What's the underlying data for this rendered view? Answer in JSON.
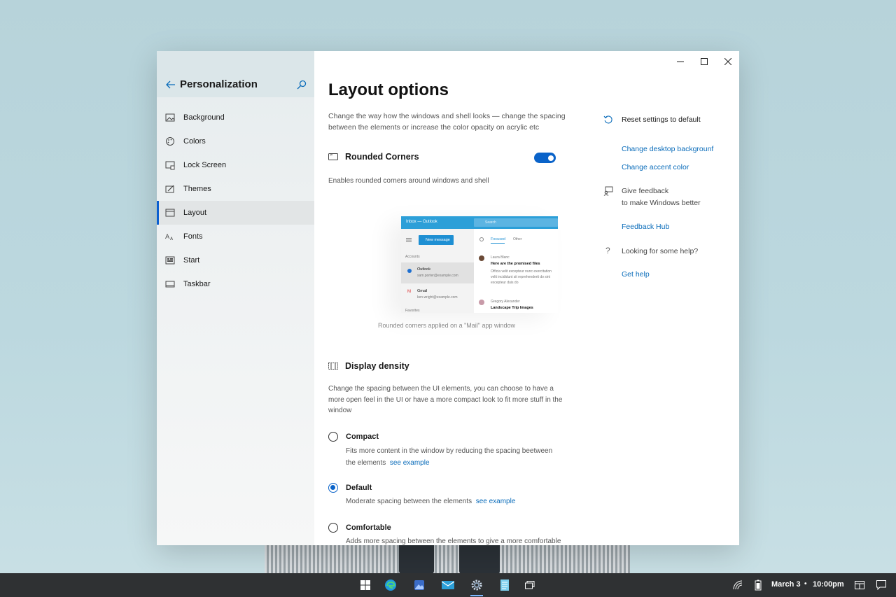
{
  "sidebar": {
    "title": "Personalization",
    "items": [
      {
        "label": "Background",
        "icon": "image-icon"
      },
      {
        "label": "Colors",
        "icon": "palette-icon"
      },
      {
        "label": "Lock Screen",
        "icon": "lock-screen-icon"
      },
      {
        "label": "Themes",
        "icon": "themes-icon"
      },
      {
        "label": "Layout",
        "icon": "layout-icon",
        "active": true
      },
      {
        "label": "Fonts",
        "icon": "fonts-icon"
      },
      {
        "label": "Start",
        "icon": "start-icon"
      },
      {
        "label": "Taskbar",
        "icon": "taskbar-icon"
      }
    ]
  },
  "main": {
    "title": "Layout options",
    "intro": "Change the way how the windows and shell looks — change the spacing between the elements or increase the color opacity on acrylic etc",
    "rounded": {
      "heading": "Rounded Corners",
      "toggle_on": true,
      "description": "Enables rounded corners around windows and shell",
      "caption": "Rounded corners applied on a \"Mail\" app window"
    },
    "preview": {
      "app_title": "Inbox — Outlook",
      "search": "Search",
      "new_message": "New message",
      "accounts": "Accounts",
      "acct1_name": "Outlook",
      "acct1_email": "sam.porter@example.com",
      "acct2_name": "Gmail",
      "acct2_email": "ken.wright@example.com",
      "favorites": "Favorites",
      "tab_focused": "Focused",
      "tab_other": "Other",
      "msg1_from": "Laura Blanc",
      "msg1_subject": "Here are the promised files",
      "msg1_body": "Officia velit excepteur nunc exercitation velit incididunt sit reprehenderit do sint excepteur duis do",
      "msg2_from": "Gregory Alexander",
      "msg2_subject": "Landscape Trip Images"
    },
    "density": {
      "heading": "Display density",
      "description": "Change the spacing between the UI elements, you can choose to have a more open feel in the UI or have a more compact look to fit more stuff in the window",
      "options": [
        {
          "label": "Compact",
          "desc": "Fits more content in the window by reducing the spacing beetween the elements",
          "link": "see example",
          "selected": false
        },
        {
          "label": "Default",
          "desc": "Moderate spacing between the elements",
          "link": "see example",
          "selected": true
        },
        {
          "label": "Comfortable",
          "desc": "Adds more spacing between the elements to give a more comfortable",
          "link": "",
          "selected": false
        }
      ]
    }
  },
  "related": {
    "reset": "Reset settings to default",
    "link_background": "Change desktop backgrounf",
    "link_accent": "Change accent color",
    "feedback_line1": "Give feedback",
    "feedback_line2": "to make Windows better",
    "feedback_hub": "Feedback Hub",
    "help_text": "Looking for some help?",
    "get_help": "Get help"
  },
  "taskbar": {
    "date": "March 3",
    "separator": "•",
    "time": "10:00pm",
    "accent": "#7fb8ff"
  },
  "colors": {
    "accent": "#0a63c9",
    "link": "#0a6cba"
  }
}
